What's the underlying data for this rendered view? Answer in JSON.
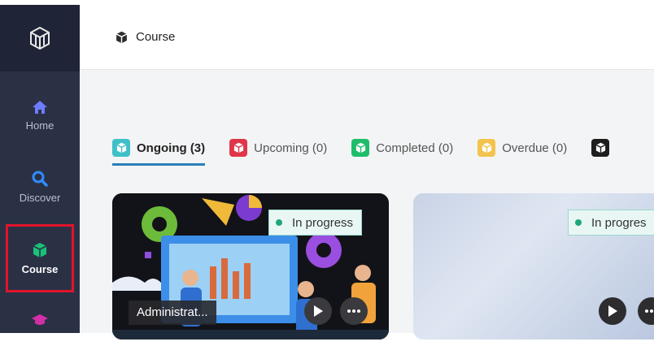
{
  "sidebar": {
    "items": [
      {
        "label": "Home",
        "icon": "home-icon",
        "color": "#6e7cff"
      },
      {
        "label": "Discover",
        "icon": "search-icon",
        "color": "#2f8cff"
      },
      {
        "label": "Course",
        "icon": "cube-icon",
        "color": "#19c27a",
        "active": true
      },
      {
        "label": "",
        "icon": "graduation-cap-icon",
        "color": "#d42fa8"
      }
    ]
  },
  "header": {
    "breadcrumb": "Course"
  },
  "tabs": [
    {
      "label": "Ongoing (3)",
      "color": "#3fc0c9",
      "active": true
    },
    {
      "label": "Upcoming (0)",
      "color": "#e0364a"
    },
    {
      "label": "Completed (0)",
      "color": "#1dbd69"
    },
    {
      "label": "Overdue (0)",
      "color": "#f2c34d"
    }
  ],
  "cards": [
    {
      "status": "In progress",
      "title": "Administrat..."
    },
    {
      "status": "In progres"
    }
  ],
  "colors": {
    "sidebar_bg": "#2b3145",
    "accent": "#2a7fb8",
    "active_outline": "#e0142b"
  }
}
